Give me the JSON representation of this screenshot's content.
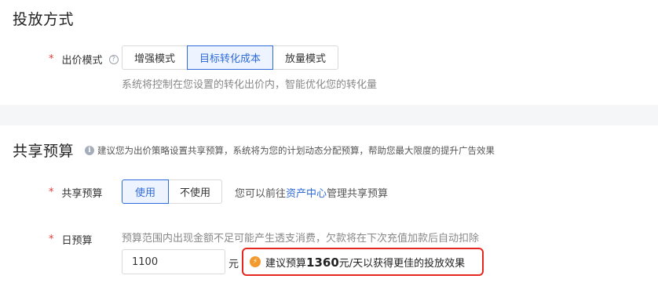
{
  "bid_section": {
    "title": "投放方式",
    "bid_mode_label": "出价模式",
    "required_mark": "*",
    "help_icon": "question-circle-icon",
    "options": [
      "增强模式",
      "目标转化成本",
      "放量模式"
    ],
    "selected": "目标转化成本",
    "description": "系统将控制在您设置的转化出价内，智能优化您的转化量"
  },
  "budget_section": {
    "title": "共享预算",
    "hint_icon": "info-circle-icon",
    "hint": "建议您为出价策略设置共享预算，系统将为您的计划动态分配预算，帮助您最大限度的提升广告效果",
    "shared_budget_label": "共享预算",
    "required_mark": "*",
    "options": [
      "使用",
      "不使用"
    ],
    "selected": "使用",
    "manage_prefix": "您可以前往",
    "manage_link": "资产中心",
    "manage_suffix": "管理共享预算",
    "daily_budget_label": "日预算",
    "daily_budget_note": "预算范围内出现金额不足可能产生透支消费，欠款将在下次充值加款后自动扣除",
    "daily_budget_value": "1100",
    "unit": "元",
    "suggestion": {
      "icon": "lightning-icon",
      "prefix": "建议预算",
      "amount": "1360",
      "suffix": "元/天以获得更佳的投放效果",
      "highlight_color": "#e5281f"
    }
  },
  "accent_color": "#2f6bdb"
}
